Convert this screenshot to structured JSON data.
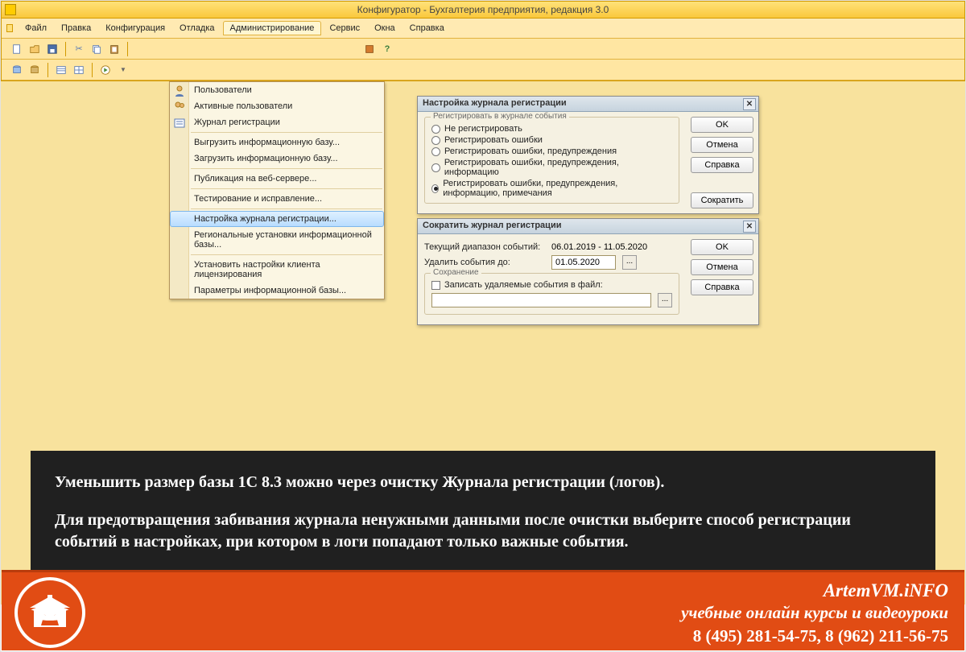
{
  "title": "Конфигуратор - Бухгалтерия предприятия, редакция 3.0",
  "menubar": [
    "Файл",
    "Правка",
    "Конфигурация",
    "Отладка",
    "Администрирование",
    "Сервис",
    "Окна",
    "Справка"
  ],
  "menubar_open_index": 4,
  "dropdown": {
    "groups": [
      [
        "Пользователи",
        "Активные пользователи",
        "Журнал регистрации"
      ],
      [
        "Выгрузить информационную базу...",
        "Загрузить информационную базу..."
      ],
      [
        "Публикация на веб-сервере..."
      ],
      [
        "Тестирование и исправление..."
      ],
      [
        "Настройка журнала регистрации...",
        "Региональные установки информационной базы..."
      ],
      [
        "Установить настройки клиента лицензирования",
        "Параметры информационной базы..."
      ]
    ],
    "selected": "Настройка журнала регистрации..."
  },
  "dialog1": {
    "title": "Настройка журнала регистрации",
    "fieldset_legend": "Регистрировать в журнале события",
    "options": [
      "Не регистрировать",
      "Регистрировать ошибки",
      "Регистрировать ошибки, предупреждения",
      "Регистрировать ошибки, предупреждения, информацию",
      "Регистрировать ошибки, предупреждения, информацию, примечания"
    ],
    "selected_index": 4,
    "buttons": {
      "ok": "OK",
      "cancel": "Отмена",
      "help": "Справка",
      "shrink": "Сократить"
    }
  },
  "dialog2": {
    "title": "Сократить журнал регистрации",
    "range_label": "Текущий диапазон событий:",
    "range_value": "06.01.2019 - 11.05.2020",
    "delete_label": "Удалить события до:",
    "delete_value": "01.05.2020",
    "save_legend": "Сохранение",
    "save_checkbox": "Записать удаляемые события в файл:",
    "file_value": "",
    "buttons": {
      "ok": "OK",
      "cancel": "Отмена",
      "help": "Справка"
    }
  },
  "overlay": {
    "p1": "Уменьшить размер базы 1С 8.3 можно через очистку Журнала регистрации (логов).",
    "p2": "Для предотвращения забивания журнала ненужными данными после очистки выберите способ регистрации событий в настройках, при котором в логи попадают только важные события."
  },
  "banner": {
    "brand": "ArtemVM.iNFO",
    "slogan": "учебные онлайн курсы и видеоуроки",
    "phones": "8 (495) 281-54-75, 8 (962) 211-56-75"
  }
}
